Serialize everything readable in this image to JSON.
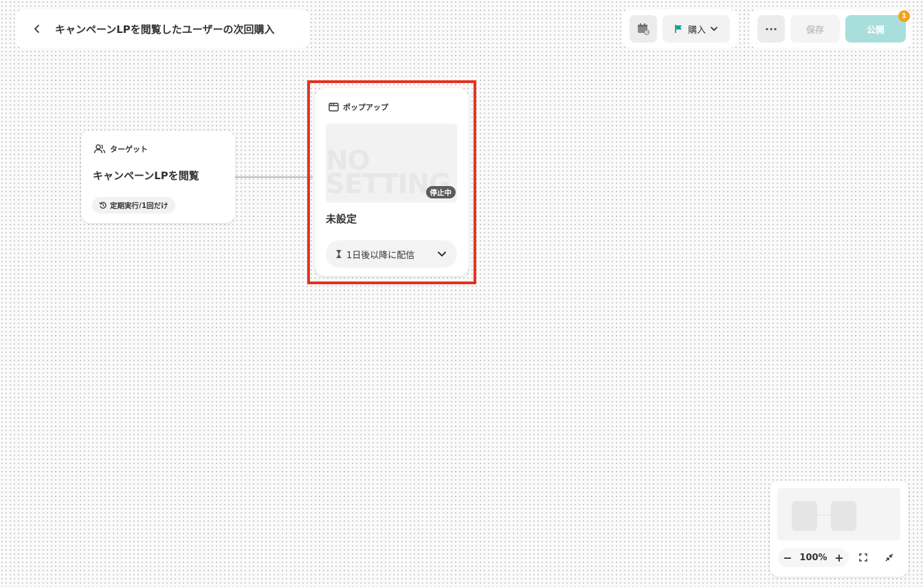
{
  "header": {
    "title": "キャンペーンLPを閲覧したユーザーの次回購入",
    "goal_label": "購入",
    "more_label": "···",
    "save_label": "保存",
    "publish_label": "公開",
    "notification_count": "1"
  },
  "target_node": {
    "type_label": "ターゲット",
    "title": "キャンペーンLPを閲覧",
    "schedule_label": "定期実行/1回だけ"
  },
  "popup_node": {
    "type_label": "ポップアップ",
    "placeholder_text": "NO\nSETTING",
    "status_badge": "停止中",
    "title": "未設定",
    "delivery_label": "1日後以降に配信"
  },
  "minimap": {
    "zoom_level": "100%",
    "zoom_out": "−",
    "zoom_in": "+"
  },
  "colors": {
    "highlight": "#e7311d",
    "publish": "#a8dfdc",
    "badge": "#f2a31e",
    "flag": "#1a9e94"
  }
}
